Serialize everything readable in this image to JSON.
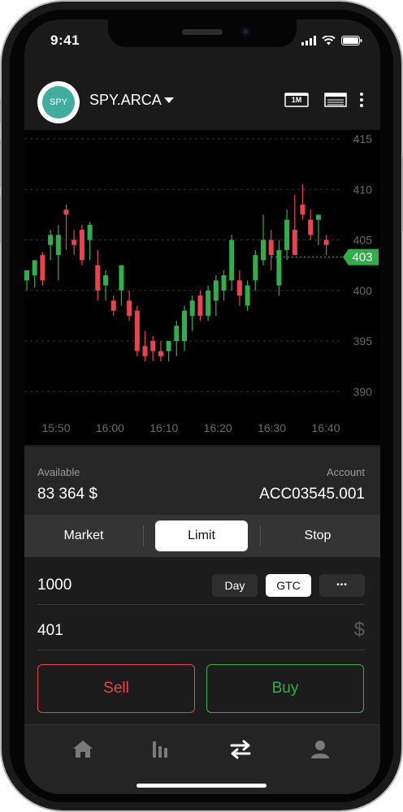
{
  "status_bar": {
    "time": "9:41"
  },
  "header": {
    "avatar_text": "SPY",
    "symbol": "SPY.ARCA",
    "interval_label": "1M"
  },
  "chart_data": {
    "type": "candlestick",
    "x_tick_labels": [
      "15:50",
      "16:00",
      "16:10",
      "16:20",
      "16:30",
      "16:40"
    ],
    "y_tick_labels": [
      "415",
      "410",
      "405",
      "400",
      "395",
      "390"
    ],
    "ylim": [
      388,
      416
    ],
    "last_price_label": "403",
    "last_price": 403.3,
    "grid": "horizontal dashed",
    "colors": {
      "up": "#2fae4a",
      "down": "#e8434f",
      "price_tag": "#2fae4a"
    },
    "candles": [
      {
        "o": 401.0,
        "h": 402.0,
        "l": 400.0,
        "c": 402.0
      },
      {
        "o": 401.5,
        "h": 403.0,
        "l": 400.3,
        "c": 403.0
      },
      {
        "o": 403.5,
        "h": 403.8,
        "l": 400.5,
        "c": 401.0
      },
      {
        "o": 404.5,
        "h": 406.0,
        "l": 403.0,
        "c": 405.5
      },
      {
        "o": 403.5,
        "h": 406.5,
        "l": 401.0,
        "c": 405.5
      },
      {
        "o": 408.0,
        "h": 408.5,
        "l": 404.0,
        "c": 407.5
      },
      {
        "o": 405.0,
        "h": 406.0,
        "l": 403.5,
        "c": 404.5
      },
      {
        "o": 406.0,
        "h": 406.5,
        "l": 402.5,
        "c": 403.0
      },
      {
        "o": 405.0,
        "h": 406.8,
        "l": 403.0,
        "c": 406.5
      },
      {
        "o": 402.5,
        "h": 404.0,
        "l": 399.0,
        "c": 400.0
      },
      {
        "o": 400.5,
        "h": 402.0,
        "l": 399.0,
        "c": 401.5
      },
      {
        "o": 399.0,
        "h": 399.5,
        "l": 397.5,
        "c": 398.0
      },
      {
        "o": 400.0,
        "h": 402.5,
        "l": 398.5,
        "c": 402.5
      },
      {
        "o": 399.0,
        "h": 400.0,
        "l": 397.0,
        "c": 397.5
      },
      {
        "o": 398.0,
        "h": 398.5,
        "l": 393.5,
        "c": 394.0
      },
      {
        "o": 394.5,
        "h": 396.0,
        "l": 393.0,
        "c": 393.5
      },
      {
        "o": 395.0,
        "h": 395.5,
        "l": 393.0,
        "c": 394.0
      },
      {
        "o": 394.0,
        "h": 395.0,
        "l": 393.0,
        "c": 393.5
      },
      {
        "o": 394.0,
        "h": 395.0,
        "l": 393.0,
        "c": 395.0
      },
      {
        "o": 395.0,
        "h": 397.0,
        "l": 393.5,
        "c": 396.5
      },
      {
        "o": 395.0,
        "h": 398.5,
        "l": 394.0,
        "c": 398.0
      },
      {
        "o": 397.5,
        "h": 399.5,
        "l": 396.0,
        "c": 399.0
      },
      {
        "o": 399.5,
        "h": 400.0,
        "l": 397.0,
        "c": 397.5
      },
      {
        "o": 397.5,
        "h": 400.5,
        "l": 397.0,
        "c": 400.0
      },
      {
        "o": 399.0,
        "h": 401.5,
        "l": 397.5,
        "c": 401.0
      },
      {
        "o": 400.0,
        "h": 402.0,
        "l": 399.0,
        "c": 401.5
      },
      {
        "o": 401.0,
        "h": 405.5,
        "l": 400.0,
        "c": 405.0
      },
      {
        "o": 401.0,
        "h": 402.0,
        "l": 398.5,
        "c": 399.5
      },
      {
        "o": 398.5,
        "h": 401.0,
        "l": 398.0,
        "c": 400.5
      },
      {
        "o": 401.0,
        "h": 404.0,
        "l": 400.0,
        "c": 403.5
      },
      {
        "o": 403.0,
        "h": 407.5,
        "l": 402.5,
        "c": 405.0
      },
      {
        "o": 405.0,
        "h": 406.0,
        "l": 402.0,
        "c": 403.5
      },
      {
        "o": 400.5,
        "h": 405.0,
        "l": 399.5,
        "c": 404.0
      },
      {
        "o": 404.0,
        "h": 408.0,
        "l": 403.0,
        "c": 407.0
      },
      {
        "o": 406.0,
        "h": 409.5,
        "l": 403.5,
        "c": 403.5
      },
      {
        "o": 408.5,
        "h": 410.5,
        "l": 407.0,
        "c": 407.5
      },
      {
        "o": 407.0,
        "h": 408.0,
        "l": 405.0,
        "c": 405.5
      },
      {
        "o": 407.0,
        "h": 407.5,
        "l": 404.5,
        "c": 407.5
      },
      {
        "o": 405.0,
        "h": 405.5,
        "l": 403.5,
        "c": 404.5
      }
    ]
  },
  "account_panel": {
    "available_label": "Available",
    "available_value": "83 364 $",
    "account_label": "Account",
    "account_value": "ACC03545.001"
  },
  "order_type": {
    "options": [
      "Market",
      "Limit",
      "Stop"
    ],
    "selected": "Limit"
  },
  "order_form": {
    "quantity": "1000",
    "duration_options": [
      "Day",
      "GTC",
      "•••"
    ],
    "duration_selected": "GTC",
    "price": "401",
    "currency_symbol": "$"
  },
  "actions": {
    "sell_label": "Sell",
    "buy_label": "Buy"
  },
  "tabbar": {
    "icons": [
      "home-icon",
      "chart-bars-icon",
      "transfer-arrows-icon",
      "profile-icon"
    ],
    "active": "transfer-arrows-icon"
  },
  "colors": {
    "sell": "#e8434f",
    "buy": "#2fae4a",
    "avatar_bg": "#3fae9c"
  }
}
